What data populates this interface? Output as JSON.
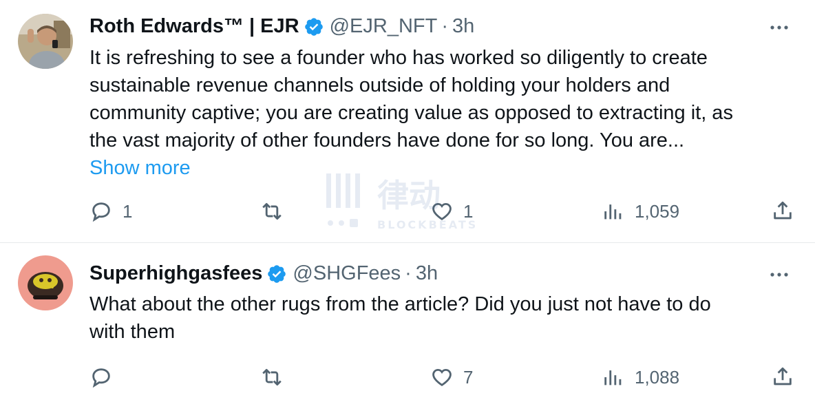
{
  "tweets": [
    {
      "author": "Roth Edwards™ | EJR",
      "handle": "@EJR_NFT",
      "separator": "·",
      "time": "3h",
      "text_lines": [
        "It is refreshing to see a founder who has worked so diligently to create",
        "sustainable revenue channels outside of holding your holders and",
        "community captive; you are creating value as opposed to extracting it, as",
        "the vast majority of other founders have done for so long. You are..."
      ],
      "show_more": "Show more",
      "replies": "1",
      "retweets": "",
      "likes": "1",
      "views": "1,059"
    },
    {
      "author": "Superhighgasfees",
      "handle": "@SHGFees",
      "separator": "·",
      "time": "3h",
      "text_lines": [
        "What about the other rugs from the article? Did you just not have to do",
        "with them"
      ],
      "replies": "",
      "retweets": "",
      "likes": "7",
      "views": "1,088"
    }
  ],
  "watermark": {
    "chinese": "律动",
    "latin": "BLOCKBEATS"
  },
  "colors": {
    "text": "#0f1419",
    "secondary": "#536471",
    "link": "#1d9bf0",
    "verified": "#1d9bf0",
    "divider": "#e6e9eb"
  },
  "icons": [
    "verified-badge-icon",
    "more-options-icon",
    "reply-icon",
    "retweet-icon",
    "like-icon",
    "views-icon",
    "share-icon"
  ]
}
